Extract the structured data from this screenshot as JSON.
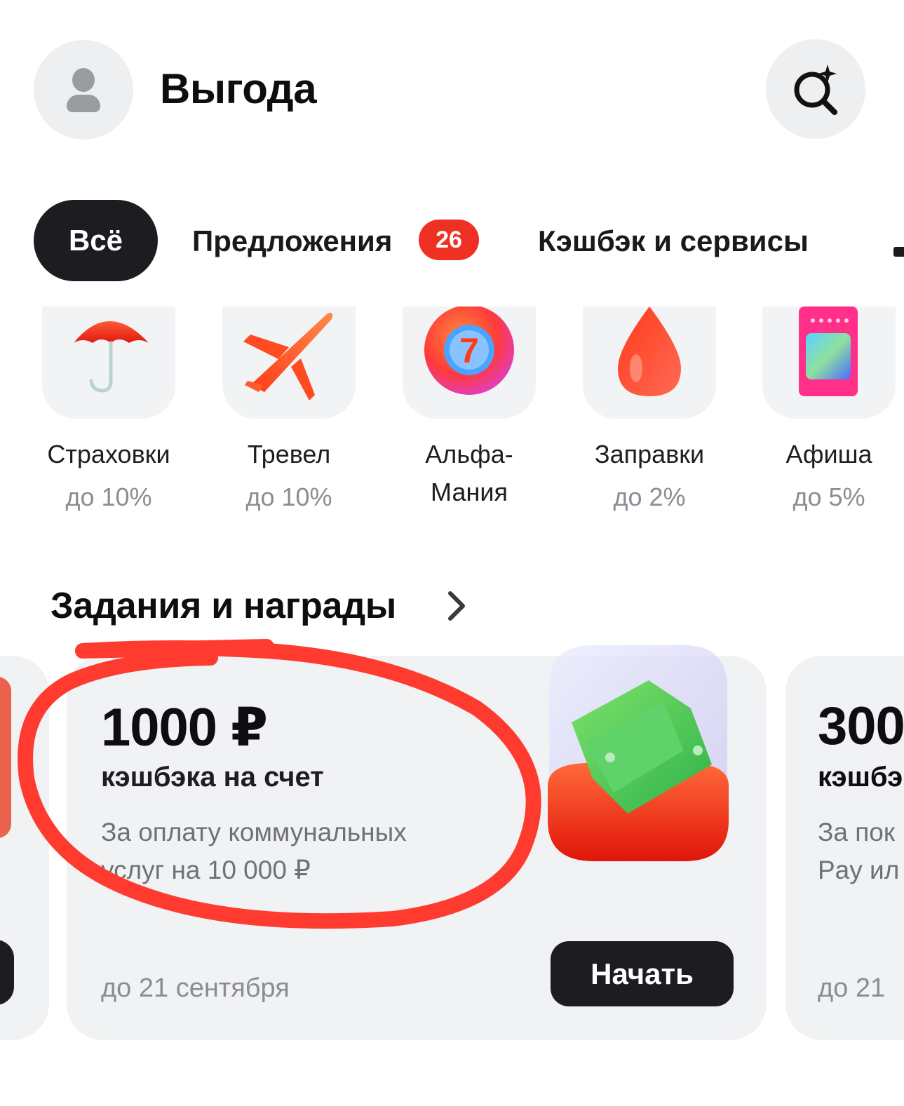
{
  "header": {
    "title": "Выгода"
  },
  "tabs": [
    {
      "label": "Всё"
    },
    {
      "label": "Предложения",
      "badge": "26"
    },
    {
      "label": "Кэшбэк и сервисы"
    }
  ],
  "categories": [
    {
      "name": "Страховки",
      "sub": "до 10%",
      "icon": "umbrella-icon"
    },
    {
      "name": "Тревел",
      "sub": "до 10%",
      "icon": "airplane-icon"
    },
    {
      "name_line1": "Альфа-",
      "name_line2": "Мания",
      "icon": "lottery-ball-icon"
    },
    {
      "name": "Заправки",
      "sub": "до 2%",
      "icon": "fuel-drop-icon"
    },
    {
      "name": "Афиша",
      "sub": "до 5%",
      "icon": "ticket-icon"
    }
  ],
  "section": {
    "title": "Задания и награды"
  },
  "cards": [
    {
      "amount": "1000 ₽",
      "desc": "кэшбэка на счет",
      "text_line1": "За оплату коммунальных",
      "text_line2": "услуг на 10 000 ₽",
      "date": "до 21 сентября",
      "button": "Начать",
      "icon": "money-box-icon"
    },
    {
      "amount": "300",
      "desc": "кэшбэ",
      "text_line1": "За пок",
      "text_line2": "Pay ил",
      "date": "до 21"
    }
  ],
  "colors": {
    "accent": "#ef3124",
    "dark": "#1d1d21",
    "annotation": "#ff3b30"
  }
}
